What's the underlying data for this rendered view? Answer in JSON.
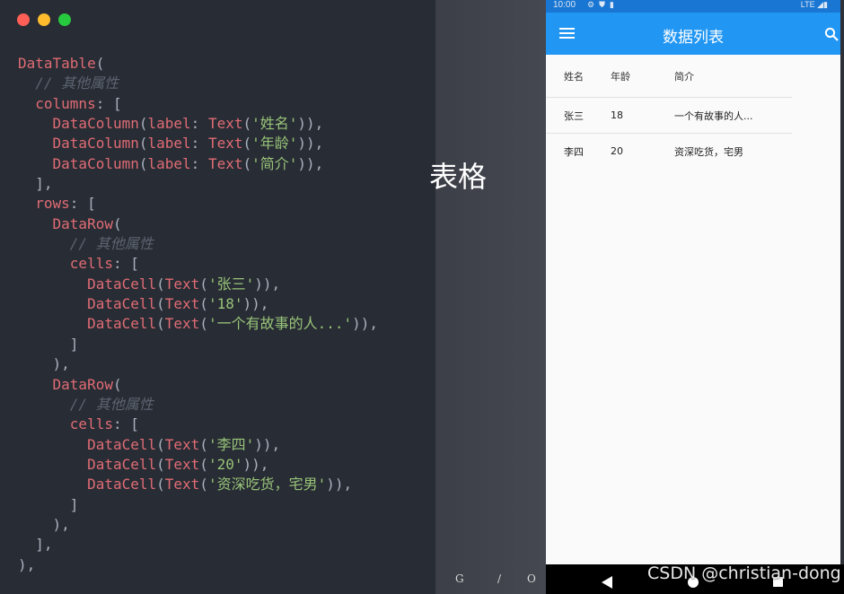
{
  "window_controls": {
    "close_color": "#ff5f56",
    "minimize_color": "#ffbd2e",
    "zoom_color": "#27c93f"
  },
  "code_lines": [
    "DataTable(",
    "  // 其他属性",
    "  columns: [",
    "    DataColumn(label: Text('姓名')),",
    "    DataColumn(label: Text('年龄')),",
    "    DataColumn(label: Text('简介')),",
    "  ],",
    "  rows: [",
    "    DataRow(",
    "      // 其他属性",
    "      cells: [",
    "        DataCell(Text('张三')),",
    "        DataCell(Text('18')),",
    "        DataCell(Text('一个有故事的人...')),",
    "      ]",
    "    ),",
    "    DataRow(",
    "      // 其他属性",
    "      cells: [",
    "        DataCell(Text('李四')),",
    "        DataCell(Text('20')),",
    "        DataCell(Text('资深吃货，宅男')),",
    "      ]",
    "    ),",
    "  ],",
    "),"
  ],
  "backdrop": {
    "title_fragment": "表格",
    "footer_letters": [
      "G",
      "/",
      "O"
    ]
  },
  "phone": {
    "status_time": "10:00",
    "status_icons": [
      "settings-icon",
      "shield-icon",
      "sd-card-icon"
    ],
    "status_network": "LTE",
    "app_title": "数据列表",
    "table": {
      "columns": [
        "姓名",
        "年龄",
        "简介"
      ],
      "rows": [
        [
          "张三",
          "18",
          "一个有故事的人..."
        ],
        [
          "李四",
          "20",
          "资深吃货，宅男"
        ]
      ]
    }
  },
  "watermark": "CSDN @christian-dong"
}
